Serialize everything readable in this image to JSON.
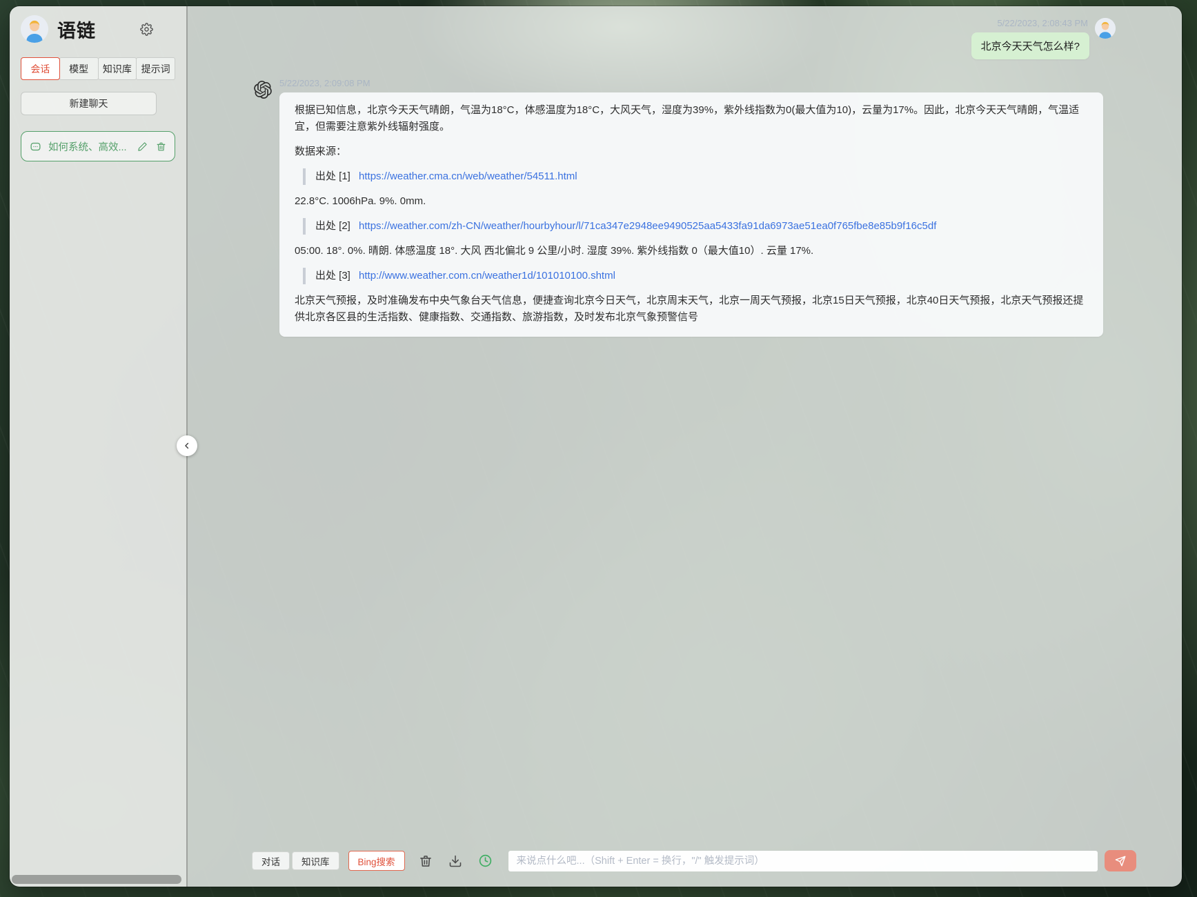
{
  "app": {
    "title": "语链"
  },
  "sidebar": {
    "tabs": [
      {
        "label": "会话",
        "active": true
      },
      {
        "label": "模型",
        "active": false
      },
      {
        "label": "知识库",
        "active": false
      },
      {
        "label": "提示词",
        "active": false
      }
    ],
    "new_chat_label": "新建聊天",
    "history": [
      {
        "title": "如何系统、高效..."
      }
    ]
  },
  "chat": {
    "user_message": {
      "timestamp": "5/22/2023, 2:08:43 PM",
      "text": "北京今天天气怎么样?"
    },
    "assistant_message": {
      "timestamp": "5/22/2023, 2:09:08 PM",
      "intro": "根据已知信息，北京今天天气晴朗，气温为18°C，体感温度为18°C，大风天气，湿度为39%，紫外线指数为0(最大值为10)，云量为17%。因此，北京今天天气晴朗，气温适宜，但需要注意紫外线辐射强度。",
      "sources_label": "数据来源：",
      "citations": [
        {
          "label": "出处 [1]",
          "url": "https://weather.cma.cn/web/weather/54511.html",
          "snippet": "22.8°C. 1006hPa. 9%. 0mm."
        },
        {
          "label": "出处 [2]",
          "url": "https://weather.com/zh-CN/weather/hourbyhour/l/71ca347e2948ee9490525aa5433fa91da6973ae51ea0f765fbe8e85b9f16c5df",
          "snippet": "05:00. 18°. 0%. 晴朗. 体感温度 18°. 大风 西北偏北 9 公里/小时. 湿度 39%. 紫外线指数 0（最大值10）. 云量 17%."
        },
        {
          "label": "出处 [3]",
          "url": "http://www.weather.com.cn/weather1d/101010100.shtml",
          "snippet": "北京天气预报，及时准确发布中央气象台天气信息，便捷查询北京今日天气，北京周末天气，北京一周天气预报，北京15日天气预报，北京40日天气预报，北京天气预报还提供北京各区县的生活指数、健康指数、交通指数、旅游指数，及时发布北京气象预警信号"
        }
      ]
    }
  },
  "composer": {
    "modes": [
      {
        "label": "对话",
        "active": false
      },
      {
        "label": "知识库",
        "active": false
      },
      {
        "label": "Bing搜索",
        "active": true
      }
    ],
    "input_placeholder": "来说点什么吧...（Shift + Enter = 换行，\"/\" 触发提示词）"
  },
  "colors": {
    "accent_red": "#e0503a",
    "brand_green": "#55a06a",
    "link_blue": "#3b72e0",
    "user_bubble": "#d6f0d2",
    "send_button": "#e88d7d"
  }
}
